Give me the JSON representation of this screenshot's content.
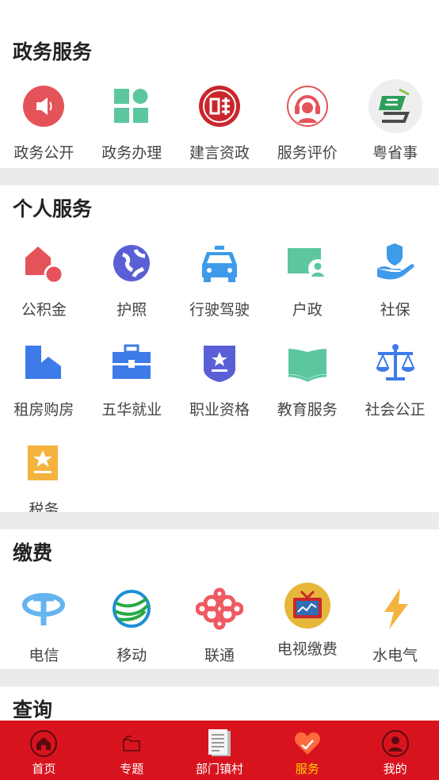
{
  "sections": {
    "gov": {
      "title": "政务服务",
      "items": [
        {
          "label": "政务公开",
          "icon": "speaker-icon"
        },
        {
          "label": "政务办理",
          "icon": "grid-apps-icon"
        },
        {
          "label": "建言资政",
          "icon": "suggestion-seal-icon"
        },
        {
          "label": "服务评价",
          "icon": "headset-agent-icon"
        },
        {
          "label": "粤省事",
          "icon": "yue-app-icon"
        }
      ]
    },
    "personal": {
      "title": "个人服务",
      "items": [
        {
          "label": "公积金",
          "icon": "housing-fund-icon"
        },
        {
          "label": "护照",
          "icon": "globe-icon"
        },
        {
          "label": "行驶驾驶",
          "icon": "taxi-icon"
        },
        {
          "label": "户政",
          "icon": "id-card-icon"
        },
        {
          "label": "社保",
          "icon": "hand-person-icon"
        },
        {
          "label": "租房购房",
          "icon": "house-icon"
        },
        {
          "label": "五华就业",
          "icon": "briefcase-icon"
        },
        {
          "label": "职业资格",
          "icon": "badge-star-icon"
        },
        {
          "label": "教育服务",
          "icon": "book-icon"
        },
        {
          "label": "社会公正",
          "icon": "scales-icon"
        },
        {
          "label": "税务",
          "icon": "tax-star-icon"
        }
      ]
    },
    "payment": {
      "title": "缴费",
      "items": [
        {
          "label": "电信",
          "icon": "china-telecom-icon"
        },
        {
          "label": "移动",
          "icon": "china-mobile-icon"
        },
        {
          "label": "联通",
          "icon": "china-unicom-icon"
        },
        {
          "label": "电视缴费",
          "icon": "tv-icon"
        },
        {
          "label": "水电气",
          "icon": "lightning-icon"
        }
      ]
    },
    "query": {
      "title": "查询"
    }
  },
  "tabbar": {
    "items": [
      {
        "label": "首页",
        "icon": "home-icon",
        "active": false
      },
      {
        "label": "专题",
        "icon": "folder-icon",
        "active": false
      },
      {
        "label": "部门镇村",
        "icon": "document-icon",
        "active": false
      },
      {
        "label": "服务",
        "icon": "heart-icon",
        "active": true
      },
      {
        "label": "我的",
        "icon": "user-icon",
        "active": false
      }
    ]
  },
  "colors": {
    "accent": "#d7141e",
    "active_tab": "#ffd200",
    "divider": "#ebebeb"
  }
}
